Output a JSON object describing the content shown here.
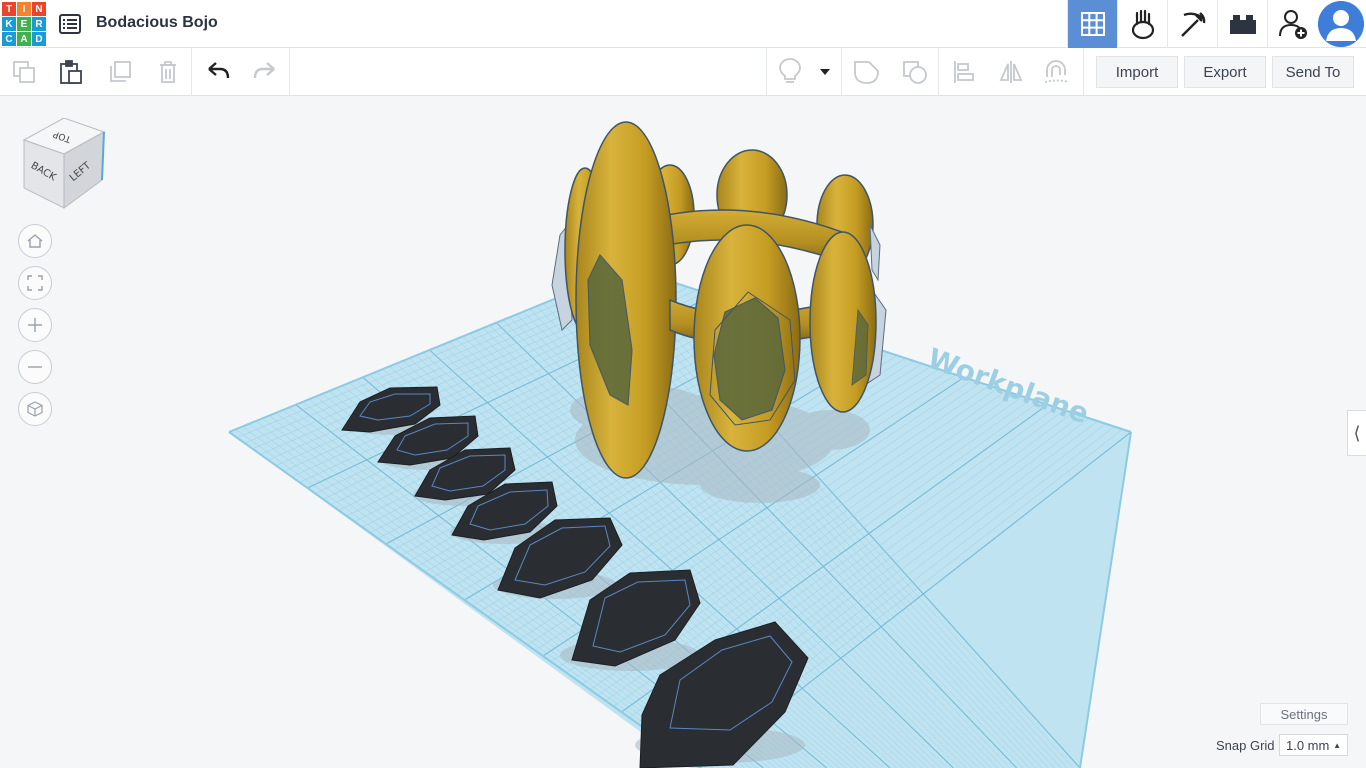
{
  "app": {
    "logo_letters": [
      "T",
      "I",
      "N",
      "K",
      "E",
      "R",
      "C",
      "A",
      "D"
    ],
    "logo_colors": [
      "#e8452c",
      "#f58231",
      "#e8452c",
      "#1a9bd7",
      "#3fb24f",
      "#1a9bd7",
      "#1a9bd7",
      "#3fb24f",
      "#1a9bd7"
    ],
    "document_title": "Bodacious Bojo",
    "accent_color": "#5c8ed6"
  },
  "header": {
    "buttons": [
      {
        "name": "3d-design-view-button",
        "icon": "grid-icon",
        "active": true
      },
      {
        "name": "blocks-view-button",
        "icon": "codeblocks-icon",
        "active": false
      },
      {
        "name": "minecraft-view-button",
        "icon": "pickaxe-icon",
        "active": false
      },
      {
        "name": "lego-view-button",
        "icon": "brick-icon",
        "active": false
      },
      {
        "name": "invite-user-button",
        "icon": "add-user-icon",
        "active": false
      }
    ],
    "avatar_icon": "user-avatar-icon"
  },
  "toolbar": {
    "import_label": "Import",
    "export_label": "Export",
    "send_to_label": "Send To"
  },
  "workplane": {
    "label": "Workplane",
    "grid_color": "#a8d8ec",
    "shape_color": "#d9a82e",
    "gem_color": "#2a2e33"
  },
  "view_cube": {
    "top": "TOP",
    "back": "BACK",
    "left": "LEFT"
  },
  "footer": {
    "settings_label": "Settings",
    "snap_grid_label": "Snap Grid",
    "snap_grid_value": "1.0 mm"
  }
}
